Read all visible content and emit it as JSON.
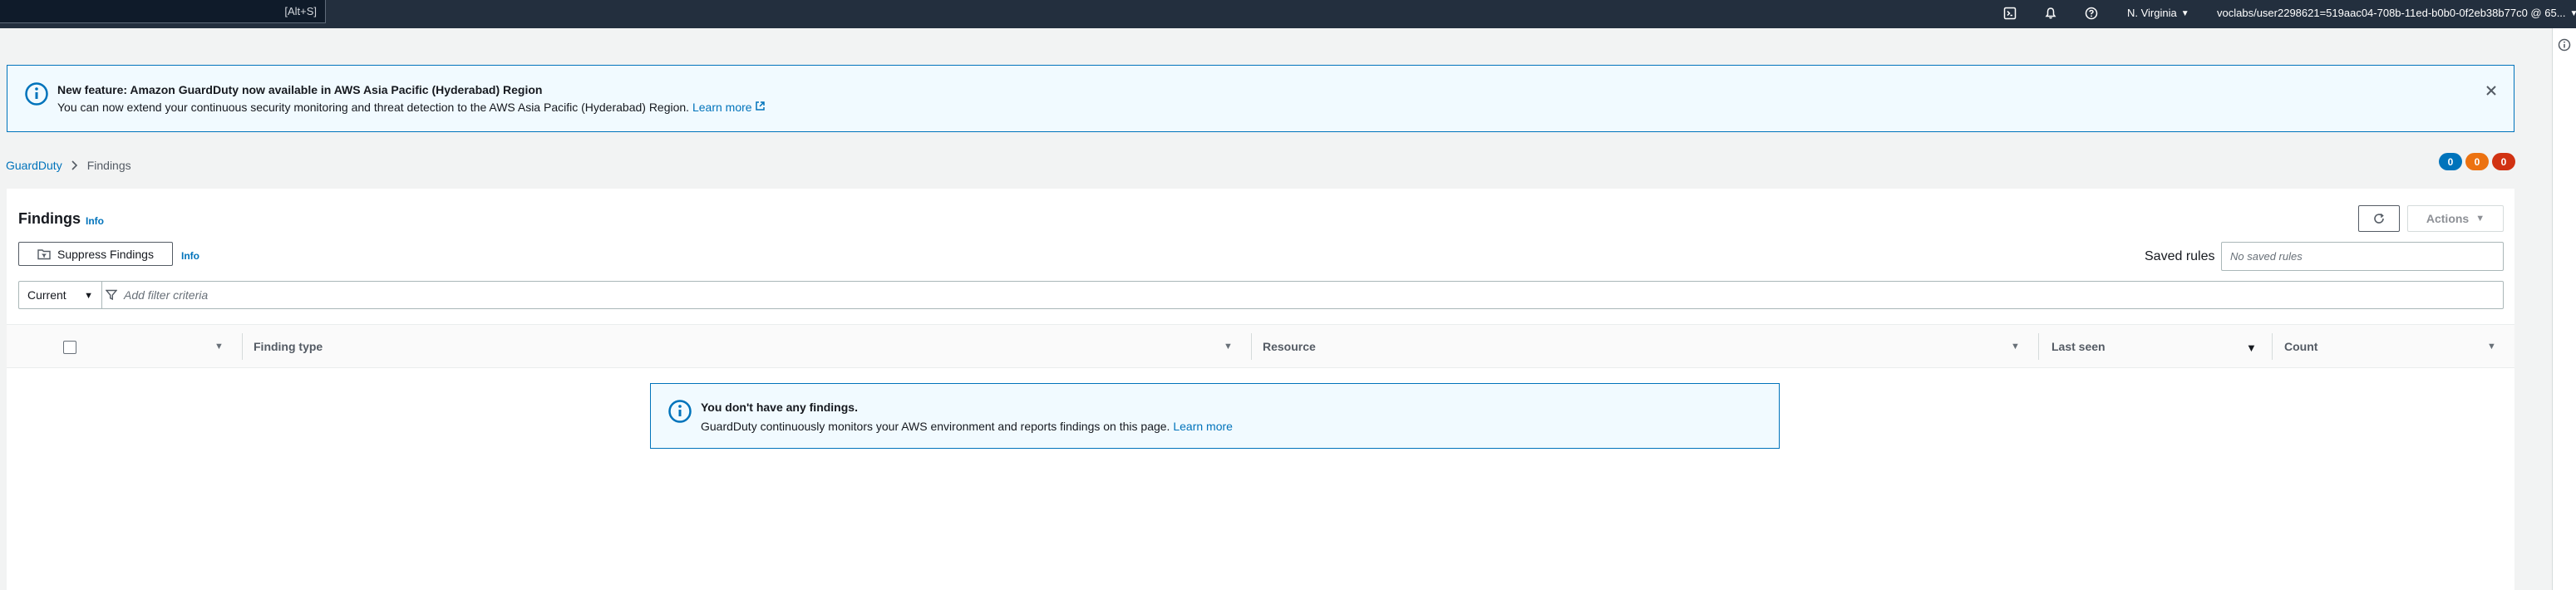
{
  "top_nav": {
    "search_shortcut": "[Alt+S]",
    "region": "N. Virginia",
    "account": "voclabs/user2298621=519aac04-708b-11ed-b0b0-0f2eb38b77c0 @ 65..."
  },
  "flash": {
    "title": "New feature: Amazon GuardDuty now available in AWS Asia Pacific (Hyderabad) Region",
    "body": "You can now extend your continuous security monitoring and threat detection to the AWS Asia Pacific (Hyderabad) Region.",
    "link": "Learn more"
  },
  "breadcrumb": {
    "root": "GuardDuty",
    "current": "Findings"
  },
  "badges": [
    {
      "value": "0",
      "color": "#0073bb"
    },
    {
      "value": "0",
      "color": "#ec7211"
    },
    {
      "value": "0",
      "color": "#d13212"
    }
  ],
  "findings": {
    "title": "Findings",
    "info": "Info",
    "suppress_label": "Suppress Findings",
    "suppress_info": "Info",
    "actions_label": "Actions",
    "saved_rules_label": "Saved rules",
    "saved_rules_placeholder": "No saved rules",
    "filter_scope": "Current",
    "filter_placeholder": "Add filter criteria"
  },
  "table": {
    "columns": [
      "Finding type",
      "Resource",
      "Last seen",
      "Count"
    ]
  },
  "empty_state": {
    "title": "You don't have any findings.",
    "body": "GuardDuty continuously monitors your AWS environment and reports findings on this page.",
    "link": "Learn more"
  },
  "colors": {
    "nav_bg": "#232f3e",
    "link": "#0073bb",
    "info_bg": "#f1faff"
  }
}
